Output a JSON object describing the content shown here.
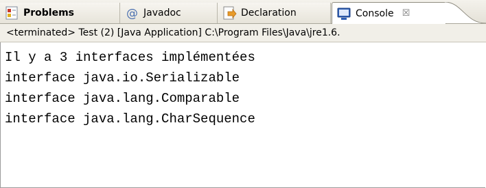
{
  "tabs": [
    {
      "label": "Problems",
      "icon": "problems-icon",
      "bold": true,
      "active": false
    },
    {
      "label": "Javadoc",
      "icon": "javadoc-icon",
      "bold": false,
      "active": false
    },
    {
      "label": "Declaration",
      "icon": "declaration-icon",
      "bold": false,
      "active": false
    },
    {
      "label": "Console",
      "icon": "console-icon",
      "bold": false,
      "active": true,
      "close_glyph": "☒"
    }
  ],
  "status": {
    "text": "<terminated> Test (2) [Java Application] C:\\Program Files\\Java\\jre1.6."
  },
  "console": {
    "lines": [
      "Il y a 3 interfaces implémentées",
      "interface java.io.Serializable",
      "interface java.lang.Comparable",
      "interface java.lang.CharSequence"
    ]
  },
  "colors": {
    "console_icon_blue": "#2f5fb5",
    "javadoc_at_blue": "#4a6fb0",
    "problems_red": "#c8382a"
  }
}
